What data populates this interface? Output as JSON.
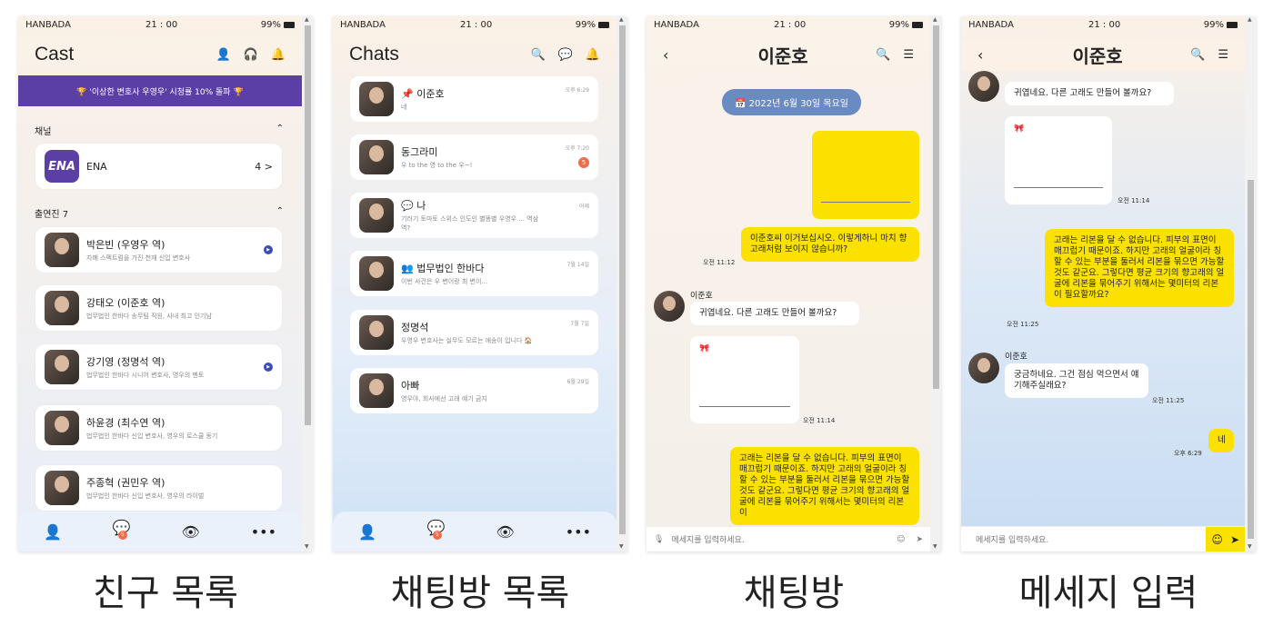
{
  "status": {
    "carrier": "HANBADA",
    "time": "21 : 00",
    "battery": "99%"
  },
  "friends": {
    "title": "Cast",
    "banner": "🏆 '이상한 변호사 우영우' 시청률 10% 돌파 🏆",
    "channel_label": "채널",
    "channel": {
      "name": "ENA",
      "logo": "ENA",
      "count": "4 >"
    },
    "cast_label": "출연진 7",
    "cast": [
      {
        "name": "박은빈 (우영우 역)",
        "desc": "자폐 스펙트럼을 가진 천재 신입 변호사",
        "play": true
      },
      {
        "name": "강태오 (이준호 역)",
        "desc": "법무법인 한바다 송무팀 직원, 사내 최고 인기남",
        "play": false
      },
      {
        "name": "강기영 (정명석 역)",
        "desc": "법무법인 한바다 시니어 변호사, 영우의 멘토",
        "play": true
      },
      {
        "name": "하윤경 (최수연 역)",
        "desc": "법무법인 한바다 신입 변호사, 영우의 로스쿨 동기",
        "play": false
      },
      {
        "name": "주종혁 (권민우 역)",
        "desc": "법무법인 한바다 신입 변호사, 영우의 라이벌",
        "play": false
      }
    ]
  },
  "chats": {
    "title": "Chats",
    "rooms": [
      {
        "name": "이준호",
        "tag": "📌",
        "preview": "네",
        "time": "오후 6:29",
        "unread": ""
      },
      {
        "name": "동그라미",
        "tag": "",
        "preview": "우 to the 영 to the 우~!",
        "time": "오후 7:20",
        "unread": "5"
      },
      {
        "name": "나",
        "tag": "💬",
        "preview": "기러기 토마토 스위스 인도인 별똥별 우영우 ... 역삼역?",
        "time": "어제",
        "unread": ""
      },
      {
        "name": "법무법인 한바다",
        "tag": "👥",
        "preview": "이번 사건은 우 변이랑 최 변이...",
        "time": "7월 14일",
        "unread": ""
      },
      {
        "name": "정명석",
        "tag": "",
        "preview": "우영우 변호사는 실무도 모르는 애송이 입니다 🏠",
        "time": "7월 7일",
        "unread": ""
      },
      {
        "name": "아빠",
        "tag": "",
        "preview": "영우야, 회사에선 고래 얘기 금지",
        "time": "6월 29일",
        "unread": ""
      }
    ]
  },
  "room": {
    "name": "이준호",
    "date": "📅 2022년 6월 30일 목요일",
    "msg1": "이준호씨 이거보십시오. 이렇게하니 마치 향고래처럼 보이지 않습니까?",
    "ts1": "오전 11:12",
    "sender": "이준호",
    "msg2": "귀엽네요. 다른 고래도 만들어 볼까요?",
    "ts2": "오전 11:14",
    "msg3": "고래는 리본을 달 수 없습니다. 피부의 표면이 매끄럽기 때문이죠. 하지만 고래의 얼굴이라 칭할 수 있는 부분을 둘러서 리본을 묶으면 가능할 것도 같군요. 그렇다면 평균 크기의 향고래의 얼굴에 리본을 묶어주기 위해서는 몇미터의 리본이",
    "placeholder": "메세지를 입력하세요."
  },
  "input": {
    "name": "이준호",
    "msg2": "귀엽네요. 다른 고래도 만들어 볼까요?",
    "ts_a": "오전 11:14",
    "msg3": "고래는 리본을 달 수 없습니다. 피부의 표면이 매끄럽기 때문이죠. 하지만 고래의 얼굴이라 칭할 수 있는 부분을 둘러서 리본을 묶으면 가능할 것도 같군요. 그렇다면 평균 크기의 향고래의 얼굴에 리본을 묶어주기 위해서는 몇미터의 리본이 필요할까요?",
    "ts_b": "오전 11:25",
    "sender": "이준호",
    "msg4": "궁금하네요. 그건 점심 먹으면서 얘기해주실래요?",
    "ts_c": "오전 11:25",
    "msg5": "네",
    "ts_d": "오후 6:29",
    "placeholder": "메세지를 입력하세요."
  },
  "captions": [
    "친구 목록",
    "채팅방 목록",
    "채팅방",
    "메세지 입력"
  ]
}
